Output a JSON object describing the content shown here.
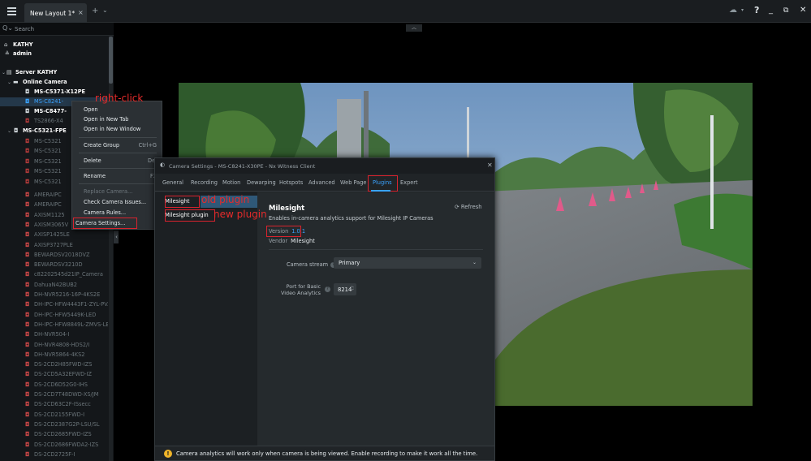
{
  "titlebar": {
    "tab_label": "New Layout 1*",
    "tab_close": "×",
    "add_tab": "+",
    "tab_menu": "⌄",
    "cloud": "☁",
    "cloud_caret": "▾",
    "help": "?",
    "minimize": "_",
    "maximize": "⧉",
    "close": "✕"
  },
  "search": {
    "placeholder": "Search",
    "icon": "Q⌄"
  },
  "tree": {
    "user_site": "KATHY",
    "user": "admin",
    "server": "Server KATHY",
    "group_online": "Online Camera",
    "cam1": "MS-C5371-X12PE",
    "cam2": "MS-C8241-",
    "cam3": "MS-C8477-",
    "cam4": "TS2866-X4",
    "group2": "MS-C5321-FPE",
    "sub1": "MS-C5321",
    "sub2": "MS-C5321",
    "sub3": "MS-C5321",
    "sub4": "MS-C5321",
    "sub5": "MS-C5321",
    "offline": [
      "AMERAIPC",
      "AMERAIPC",
      "AXISM1125",
      "AXISM3065V",
      "AXISP1425LE",
      "AXISP3727PLE",
      "BEWARDSV2018DVZ",
      "BEWARDSV3210D",
      "c82202545d21IP_Camera",
      "DahuaN42BUB2",
      "DH-NVR5216-16P-4KS2E",
      "DH-IPC-HFW4443F1-ZYL-PV...",
      "DH-IPC-HFW5449K-LED",
      "DH-IPC-HFW8849L-ZMVS-LED",
      "DH-NVR504-I",
      "DH-NVR4808-HDS2/I",
      "DH-NVR5864-4KS2",
      "DS-2CD2H85FWD-IZS",
      "DS-2CD5A32EFWD-IZ",
      "DS-2CD6D52G0-IHS",
      "DS-2CD7T48DWD-XS/JM",
      "DS-2CD63C2F-ISsecc",
      "DS-2CD2155FWD-I",
      "DS-2CD2387G2P-LSU/SL",
      "DS-2CD2685FWD-IZS",
      "DS-2CD2686FWDA2-IZS",
      "DS-2CD2725F-I"
    ]
  },
  "context_menu": {
    "open": "Open",
    "open_tab": "Open in New Tab",
    "open_window": "Open in New Window",
    "create_group": "Create Group",
    "create_group_sc": "Ctrl+G",
    "delete": "Delete",
    "delete_sc": "Del",
    "rename": "Rename",
    "rename_sc": "F2",
    "replace": "Replace Camera...",
    "check": "Check Camera Issues...",
    "rules": "Camera Rules...",
    "settings": "Camera Settings..."
  },
  "dialog": {
    "title": "Camera Settings - MS-C8241-X30PE - Nx Witness Client",
    "tabs": [
      "General",
      "Recording",
      "Motion",
      "Dewarping",
      "Hotspots",
      "Advanced",
      "Web Page",
      "Plugins",
      "Expert"
    ],
    "plugins": [
      "Milesight",
      "Milesight plugin"
    ],
    "plugin_name": "Milesight",
    "refresh": "Refresh",
    "description": "Enables in-camera analytics support for Milesight IP Cameras",
    "version_label": "Version",
    "version_value": "1.0.1",
    "vendor_label": "Vendor",
    "vendor_value": "Milesight",
    "stream_label": "Camera stream",
    "stream_value": "Primary",
    "port_label": "Port for Basic Video Analytics",
    "port_value": "8214",
    "footer_warning": "Camera analytics will work only when camera is being viewed. Enable recording to make it work all the time."
  },
  "annotations": {
    "right_click": "right-click",
    "old_plugin": "old plugin",
    "new_plugin": "new plugin"
  },
  "colors": {
    "accent": "#3aa3ff",
    "annotation": "#e62b2b",
    "warning": "#f0b429"
  }
}
